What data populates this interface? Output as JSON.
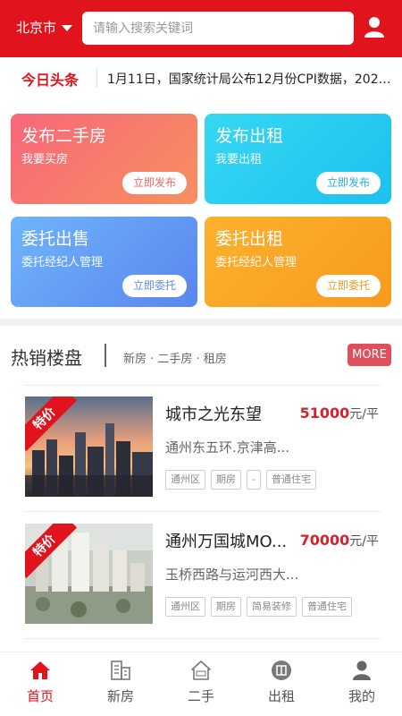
{
  "header": {
    "city": "北京市",
    "search_placeholder": "请输入搜索关键词",
    "icons": {
      "dropdown": "caret-down-icon",
      "user": "user-icon"
    }
  },
  "news": {
    "label": "今日头条",
    "text": "1月11日，国家统计局公布12月份CPI数据，2020..."
  },
  "actions": [
    {
      "title": "发布二手房",
      "subtitle": "我要买房",
      "button": "立即发布",
      "color": "#f7677a"
    },
    {
      "title": "发布出租",
      "subtitle": "我要出租",
      "button": "立即发布",
      "color": "#35d8f2"
    },
    {
      "title": "委托出售",
      "subtitle": "委托经纪人管理",
      "button": "立即委托",
      "color": "#6fb4fb"
    },
    {
      "title": "委托出租",
      "subtitle": "委托经纪人管理",
      "button": "立即委托",
      "color": "#fcb12d"
    }
  ],
  "hot": {
    "title": "热销楼盘",
    "subtitle": "新房 · 二手房 · 租房",
    "more": "MORE"
  },
  "listings": [
    {
      "badge": "特价",
      "title": "城市之光东望",
      "price": "51000",
      "unit": "元/平",
      "address": "通州东五环.京津高...",
      "tags": [
        "通州区",
        "期房",
        "-",
        "普通住宅"
      ]
    },
    {
      "badge": "特价",
      "title": "通州万国城MO...",
      "price": "70000",
      "unit": "元/平",
      "address": "玉桥西路与运河西大...",
      "tags": [
        "通州区",
        "期房",
        "简易装修",
        "普通住宅"
      ]
    }
  ],
  "tabbar": [
    {
      "label": "首页",
      "icon": "home-icon",
      "active": true
    },
    {
      "label": "新房",
      "icon": "building-icon",
      "active": false
    },
    {
      "label": "二手",
      "icon": "house-sale-icon",
      "active": false
    },
    {
      "label": "出租",
      "icon": "rent-icon",
      "active": false
    },
    {
      "label": "我的",
      "icon": "person-icon",
      "active": false
    }
  ],
  "colors": {
    "brand_red": "#e1141e",
    "price_red": "#d4232d"
  }
}
